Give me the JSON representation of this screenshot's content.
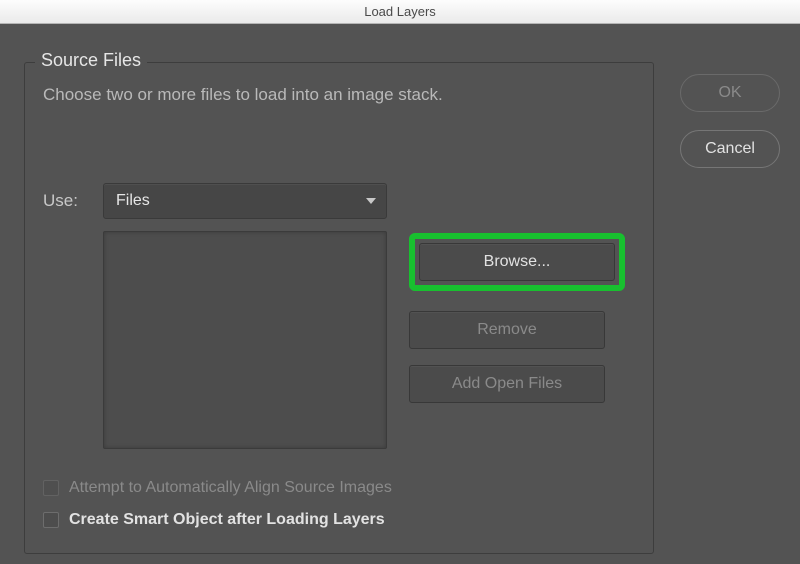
{
  "window": {
    "title": "Load Layers"
  },
  "panel": {
    "title": "Source Files",
    "description": "Choose two or more files to load into an image stack.",
    "use_label": "Use:",
    "use_value": "Files",
    "buttons": {
      "browse": "Browse...",
      "remove": "Remove",
      "add_open": "Add Open Files"
    },
    "checks": {
      "align": "Attempt to Automatically Align Source Images",
      "smart": "Create Smart Object after Loading Layers"
    }
  },
  "actions": {
    "ok": "OK",
    "cancel": "Cancel"
  },
  "highlight_color": "#18c02f"
}
